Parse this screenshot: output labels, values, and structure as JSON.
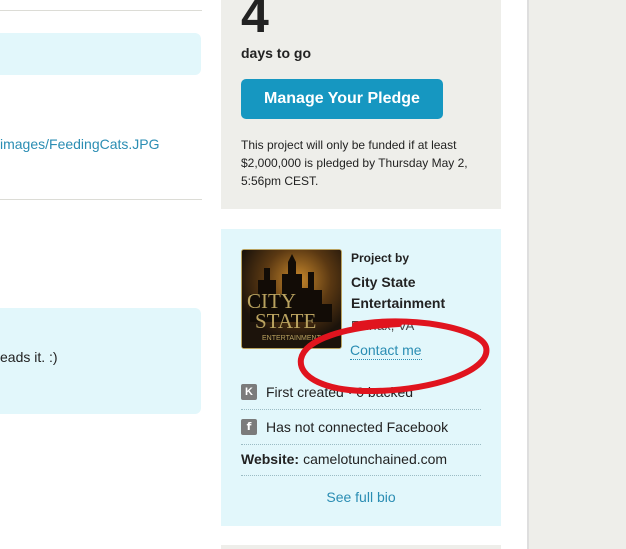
{
  "left": {
    "image_link": "images/FeedingCats.JPG",
    "comment_text": "eads it. :)"
  },
  "pledge": {
    "days_count": "4",
    "days_label": "days to go",
    "manage_button": "Manage Your Pledge",
    "funding_note": "This project will only be funded if at least $2,000,000 is pledged by Thursday May 2, 5:56pm CEST."
  },
  "creator": {
    "project_by": "Project by",
    "name": "City State Entertainment",
    "location": "Fairfax, VA",
    "contact": "Contact me",
    "first_created": "First created · 0 backed",
    "facebook": "Has not connected Facebook",
    "website_label": "Website:",
    "website_value": "camelotunchained.com",
    "full_bio": "See full bio",
    "logo_text_1": "CITY",
    "logo_text_2": "STATE",
    "logo_text_3": "ENTERTAINMENT"
  },
  "icons": {
    "kickstarter": "kickstarter-icon",
    "facebook": "facebook-icon"
  },
  "colors": {
    "button": "#1697c1",
    "link": "#2a8db3",
    "info_bg": "#e2f7fb",
    "panel_bg": "#eeeeea",
    "annotation": "#e0141e"
  }
}
